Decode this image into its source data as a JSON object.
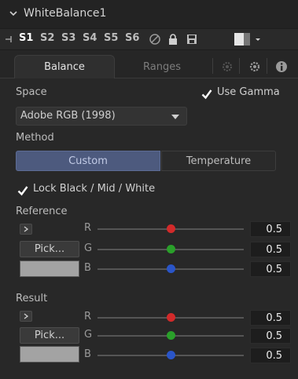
{
  "title": "WhiteBalance1",
  "slots": [
    "S1",
    "S2",
    "S3",
    "S4",
    "S5",
    "S6"
  ],
  "tabs": {
    "balance": "Balance",
    "ranges": "Ranges"
  },
  "space": {
    "label": "Space",
    "value": "Adobe RGB (1998)"
  },
  "use_gamma": {
    "label": "Use Gamma",
    "checked": true
  },
  "method": {
    "label": "Method",
    "options": [
      "Custom",
      "Temperature"
    ],
    "selected": "Custom"
  },
  "lock": {
    "label": "Lock Black / Mid / White",
    "checked": true
  },
  "reference": {
    "label": "Reference",
    "pick_label": "Pick...",
    "swatch_color": "#a3a3a3",
    "channels": [
      {
        "name": "R",
        "value": "0.5",
        "color": "#d22a2a"
      },
      {
        "name": "G",
        "value": "0.5",
        "color": "#2aa02a"
      },
      {
        "name": "B",
        "value": "0.5",
        "color": "#2a55c8"
      }
    ]
  },
  "result": {
    "label": "Result",
    "pick_label": "Pick...",
    "swatch_color": "#a3a3a3",
    "channels": [
      {
        "name": "R",
        "value": "0.5",
        "color": "#d22a2a"
      },
      {
        "name": "G",
        "value": "0.5",
        "color": "#2aa02a"
      },
      {
        "name": "B",
        "value": "0.5",
        "color": "#2a55c8"
      }
    ]
  },
  "colors": {
    "accent": "#4d5a7e",
    "background": "#282828"
  }
}
